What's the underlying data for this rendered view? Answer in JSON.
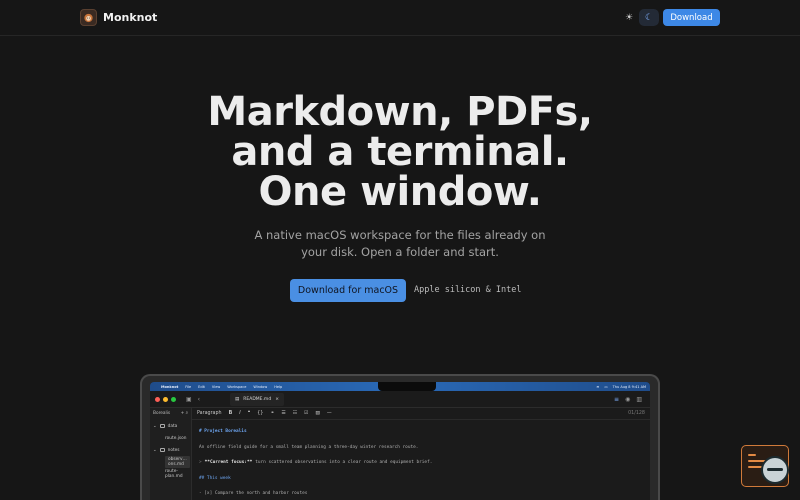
{
  "nav": {
    "brand": "Monknot",
    "download_label": "Download",
    "theme_light_icon": "sun-icon",
    "theme_dark_icon": "moon-icon"
  },
  "hero": {
    "title_lines": [
      "Markdown, PDFs,",
      "and a terminal.",
      "One window."
    ],
    "subtitle": "A native macOS workspace for the files already on your disk. Open a folder and start.",
    "cta_label": "Download for macOS",
    "cta_note": "Apple silicon & Intel"
  },
  "mockup": {
    "menubar": {
      "items": [
        "Monknot",
        "File",
        "Edit",
        "View",
        "Workspace",
        "Window",
        "Help"
      ],
      "clock": "Thu Aug 8  9:41 AM"
    },
    "tab_label": "README.md",
    "sidebar": {
      "root": "Borealis",
      "items": [
        {
          "label": "data",
          "type": "folder",
          "level": 0
        },
        {
          "label": "route.json",
          "type": "file",
          "level": 1
        },
        {
          "label": "notes",
          "type": "folder",
          "level": 0
        },
        {
          "label": "observ…ons.md",
          "type": "file",
          "level": 1
        },
        {
          "label": "route-plan.md",
          "type": "file",
          "level": 1
        }
      ]
    },
    "editor": {
      "block_style": "Paragraph",
      "position": "01/128",
      "lines": [
        {
          "kind": "h1",
          "text": "# Project Borealis"
        },
        {
          "kind": "p",
          "text": "An offline field guide for a small team planning a three-day winter research route."
        },
        {
          "kind": "quote",
          "marker": ">",
          "bold": "**Current focus:**",
          "text": "turn scattered observations into a clear route and equipment brief."
        },
        {
          "kind": "h2",
          "text": "## This week"
        },
        {
          "kind": "p",
          "text": "- [x] Compare the north and harbor routes"
        }
      ]
    }
  },
  "colors": {
    "background": "#161616",
    "accent": "#4a8fe3",
    "heading_in_editor": "#6fa8f5",
    "widget_border": "#d07a3a"
  }
}
